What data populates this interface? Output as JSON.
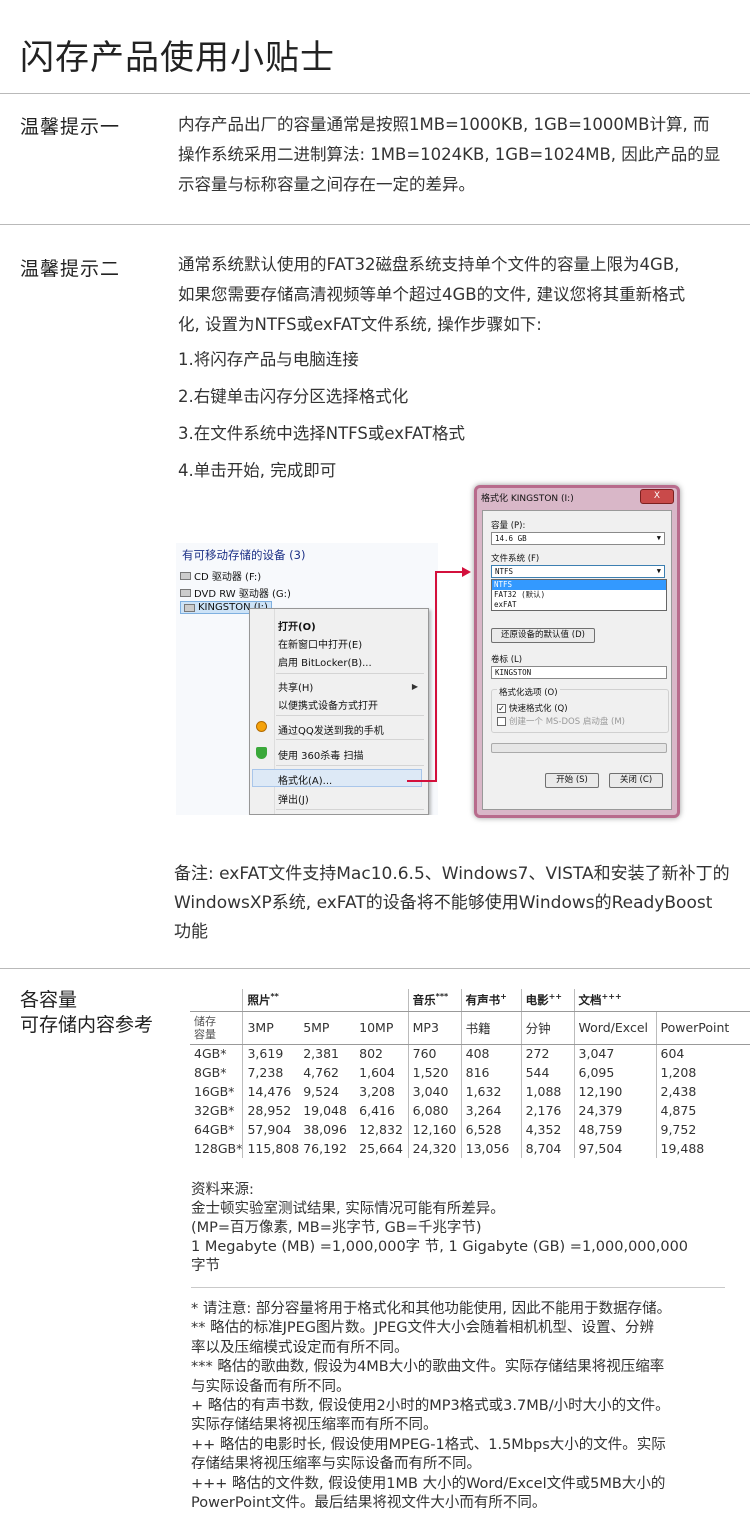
{
  "page_title": "闪存产品使用小贴士",
  "tip1": {
    "label": "温馨提示一",
    "lines": [
      "内存产品出厂的容量通常是按照1MB=1000KB, 1GB=1000MB计算, 而",
      "操作系统采用二进制算法: 1MB=1024KB, 1GB=1024MB, 因此产品的显",
      "示容量与标称容量之间存在一定的差异。"
    ]
  },
  "tip2": {
    "label": "温馨提示二",
    "lines": [
      "通常系统默认使用的FAT32磁盘系统支持单个文件的容量上限为4GB,",
      "如果您需要存储高清视频等单个超过4GB的文件, 建议您将其重新格式",
      "化, 设置为NTFS或exFAT文件系统, 操作步骤如下:"
    ],
    "steps": [
      "1.将闪存产品与电脑连接",
      "2.右键单击闪存分区选择格式化",
      "3.在文件系统中选择NTFS或exFAT格式",
      "4.单击开始, 完成即可"
    ]
  },
  "explorer": {
    "category": "有可移动存储的设备 (3)",
    "devices": [
      "CD 驱动器 (F:)",
      "DVD RW 驱动器 (G:)",
      "KINGSTON (I:)"
    ],
    "menu": {
      "open": "打开(O)",
      "open_new": "在新窗口中打开(E)",
      "bitlocker": "启用 BitLocker(B)...",
      "share": "共享(H)",
      "portable": "以便携式设备方式打开",
      "qq": "通过QQ发送到我的手机",
      "scan360": "使用 360杀毒 扫描",
      "format": "格式化(A)...",
      "eject": "弹出(J)"
    }
  },
  "format_dialog": {
    "title": "格式化 KINGSTON (I:)",
    "close": "X",
    "capacity_label": "容量 (P):",
    "capacity_value": "14.6 GB",
    "fs_label": "文件系统 (F)",
    "fs_value": "NTFS",
    "fs_options": [
      "NTFS",
      "FAT32 (默认)",
      "exFAT"
    ],
    "restore_button": "还原设备的默认值 (D)",
    "volume_label": "卷标 (L)",
    "volume_value": "KINGSTON",
    "options_label": "格式化选项 (O)",
    "quick_format": "快速格式化 (Q)",
    "msdos": "创建一个 MS-DOS 启动盘 (M)",
    "start_button": "开始 (S)",
    "close_button": "关闭 (C)"
  },
  "note": {
    "lines": [
      "备注: exFAT文件支持Mac10.6.5、Windows7、VISTA和安装了新补丁的",
      "WindowsXP系统, exFAT的设备将不能够使用Windows的ReadyBoost",
      "功能"
    ]
  },
  "capacity": {
    "label_line1": "各容量",
    "label_line2": "可存储内容参考",
    "groups": {
      "photo": "照片",
      "photo_mark": "**",
      "music": "音乐",
      "music_mark": "***",
      "audiobook": "有声书",
      "audiobook_mark": "+",
      "movie": "电影",
      "movie_mark": "++",
      "doc": "文档",
      "doc_mark": "+++"
    },
    "head_storage_1": "储存",
    "head_storage_2": "容量",
    "columns": [
      "3MP",
      "5MP",
      "10MP",
      "MP3",
      "书籍",
      "分钟",
      "Word/Excel",
      "PowerPoint"
    ],
    "rows": [
      [
        "4GB*",
        "3,619",
        "2,381",
        "802",
        "760",
        "408",
        "272",
        "3,047",
        "604"
      ],
      [
        "8GB*",
        "7,238",
        "4,762",
        "1,604",
        "1,520",
        "816",
        "544",
        "6,095",
        "1,208"
      ],
      [
        "16GB*",
        "14,476",
        "9,524",
        "3,208",
        "3,040",
        "1,632",
        "1,088",
        "12,190",
        "2,438"
      ],
      [
        "32GB*",
        "28,952",
        "19,048",
        "6,416",
        "6,080",
        "3,264",
        "2,176",
        "24,379",
        "4,875"
      ],
      [
        "64GB*",
        "57,904",
        "38,096",
        "12,832",
        "12,160",
        "6,528",
        "4,352",
        "48,759",
        "9,752"
      ],
      [
        "128GB*",
        "115,808",
        "76,192",
        "25,664",
        "24,320",
        "13,056",
        "8,704",
        "97,504",
        "19,488"
      ]
    ]
  },
  "source": {
    "lines": [
      "资料来源:",
      "金士顿实验室测试结果, 实际情况可能有所差异。",
      "(MP=百万像素, MB=兆字节, GB=千兆字节)",
      "1 Megabyte (MB) =1,000,000字 节, 1 Gigabyte (GB) =1,000,000,000",
      "字节"
    ]
  },
  "footnotes": {
    "lines": [
      "* 请注意: 部分容量将用于格式化和其他功能使用, 因此不能用于数据存储。",
      "** 略估的标准JPEG图片数。JPEG文件大小会随着相机机型、设置、分辨",
      "率以及压缩模式设定而有所不同。",
      "*** 略估的歌曲数, 假设为4MB大小的歌曲文件。实际存储结果将视压缩率",
      "与实际设备而有所不同。",
      "+ 略估的有声书数, 假设使用2小时的MP3格式或3.7MB/小时大小的文件。",
      "实际存储结果将视压缩率而有所不同。",
      "++ 略估的电影时长, 假设使用MPEG-1格式、1.5Mbps大小的文件。实际",
      "存储结果将视压缩率与实际设备而有所不同。",
      "+++ 略估的文件数, 假设使用1MB 大小的Word/Excel文件或5MB大小的",
      "PowerPoint文件。最后结果将视文件大小而有所不同。"
    ]
  }
}
